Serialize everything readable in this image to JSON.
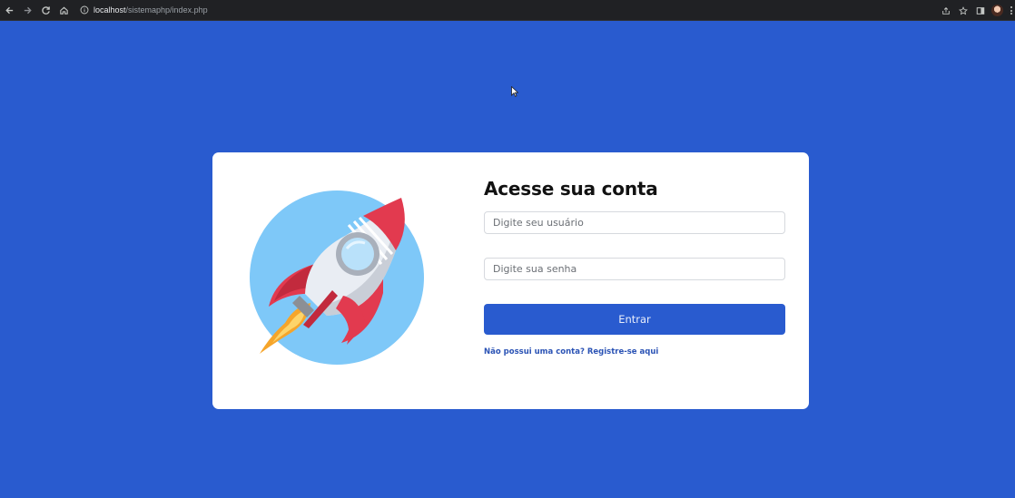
{
  "browser": {
    "url_host": "localhost",
    "url_path": "/sistemaphp/index.php"
  },
  "login": {
    "title": "Acesse sua conta",
    "username_placeholder": "Digite seu usuário",
    "password_placeholder": "Digite sua senha",
    "submit_label": "Entrar",
    "register_link": "Não possui uma conta? Registre-se aqui"
  },
  "colors": {
    "page_background": "#295bcf",
    "button_background": "#295bcf",
    "link": "#2b53b5",
    "illustration_circle": "#7ec8f8"
  },
  "icons": {
    "illustration": "rocket-icon"
  }
}
